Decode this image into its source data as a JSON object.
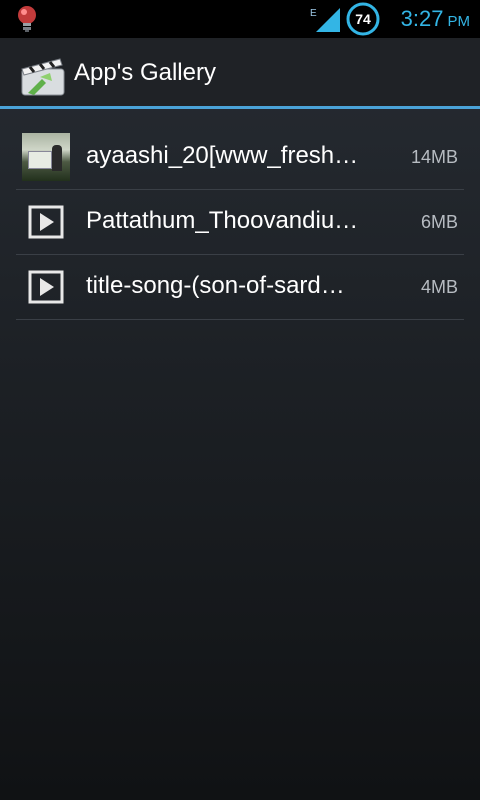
{
  "status_bar": {
    "network_label": "E",
    "battery_level": "74",
    "time": "3:27",
    "ampm": "PM",
    "notification_icon": "lightbulb-icon",
    "signal_icon": "signal-icon"
  },
  "action_bar": {
    "app_icon": "clapperboard-icon",
    "title": "App's Gallery",
    "accent_color": "#4aa3d8"
  },
  "files": [
    {
      "name": "ayaashi_20[www_fresh…",
      "size": "14MB",
      "icon": "video-thumbnail"
    },
    {
      "name": "Pattathum_Thoovandiu…",
      "size": "6MB",
      "icon": "play-icon"
    },
    {
      "name": "title-song-(son-of-sard…",
      "size": "4MB",
      "icon": "play-icon"
    }
  ]
}
